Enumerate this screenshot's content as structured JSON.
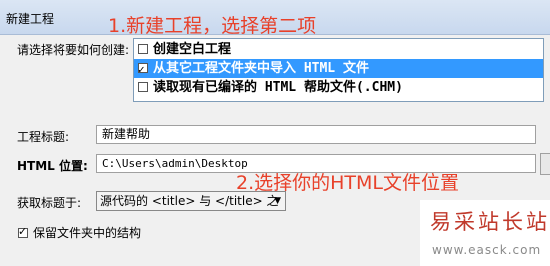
{
  "window": {
    "title": "新建工程"
  },
  "annotations": {
    "step1": "1.新建工程，选择第二项",
    "step2": "2.选择你的HTML文件位置"
  },
  "create_mode": {
    "label": "请选择将要如何创建:",
    "options": [
      {
        "label": "创建空白工程",
        "checked": false,
        "selected": false
      },
      {
        "label": "从其它工程文件夹中导入 HTML 文件",
        "checked": true,
        "selected": true
      },
      {
        "label": "读取现有已编译的 HTML 帮助文件(.CHM)",
        "checked": false,
        "selected": false
      }
    ]
  },
  "project_title": {
    "label": "工程标题:",
    "value": "新建帮助"
  },
  "html_location": {
    "label": "HTML 位置:",
    "value": "C:\\Users\\admin\\Desktop"
  },
  "title_source": {
    "label": "获取标题于:",
    "value": "源代码的 <title> 与 </title> 之"
  },
  "keep_structure": {
    "label": "保留文件夹中的结构",
    "checked": true
  },
  "watermark": {
    "text": "易采站长站",
    "url": "www.easck.com"
  },
  "colors": {
    "annotation": "#e8412a",
    "selection": "#3399ff",
    "watermark": "#c0392b"
  }
}
